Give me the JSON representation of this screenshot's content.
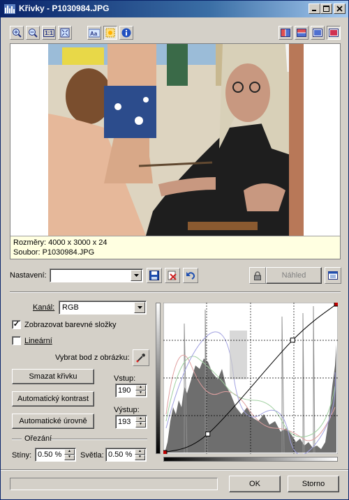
{
  "window": {
    "title": "Křivky - P1030984.JPG",
    "caption_buttons": [
      "minimize",
      "maximize",
      "close"
    ]
  },
  "toolbar": {
    "left_icons": [
      "zoom-in-icon",
      "zoom-out-icon",
      "actual-size-icon",
      "fit-window-icon",
      "text-icon",
      "sun-icon",
      "info-icon"
    ],
    "right_icons": [
      "split-vertical-icon",
      "split-horizontal-icon",
      "single-view-icon",
      "red-view-icon"
    ],
    "actual_size_label": "1:1"
  },
  "preview": {
    "dimensions": "Rozměry: 4000 x 3000 x 24",
    "file": "Soubor: P1030984.JPG"
  },
  "settings": {
    "label": "Nastavení:",
    "value": "",
    "preview_button": "Náhled"
  },
  "controls": {
    "channel_label": "Kanál:",
    "channel_value": "RGB",
    "show_color_components": "Zobrazovat barevné složky",
    "show_color_components_checked": true,
    "linear": "Lineární",
    "linear_checked": false,
    "pick_point": "Vybrat bod z obrázku:",
    "clear_curve": "Smazat křivku",
    "auto_contrast": "Automatický kontrast",
    "auto_levels": "Automatické úrovně",
    "input_label": "Vstup:",
    "input_value": "190",
    "output_label": "Výstup:",
    "output_value": "193",
    "clipping_label": "Ořezání",
    "shadows_label": "Stíny:",
    "shadows_value": "0.50 %",
    "highlights_label": "Světla:",
    "highlights_value": "0.50 %"
  },
  "footer": {
    "ok": "OK",
    "cancel": "Storno"
  },
  "colors": {
    "titlebar_start": "#0a246a",
    "titlebar_end": "#a6caf0",
    "face": "#d4d0c8",
    "info_background": "#ffffe1",
    "curve_point": "#c00000"
  },
  "curve": {
    "control_points": [
      [
        0,
        0
      ],
      [
        64,
        32
      ],
      [
        190,
        193
      ],
      [
        255,
        255
      ]
    ]
  }
}
